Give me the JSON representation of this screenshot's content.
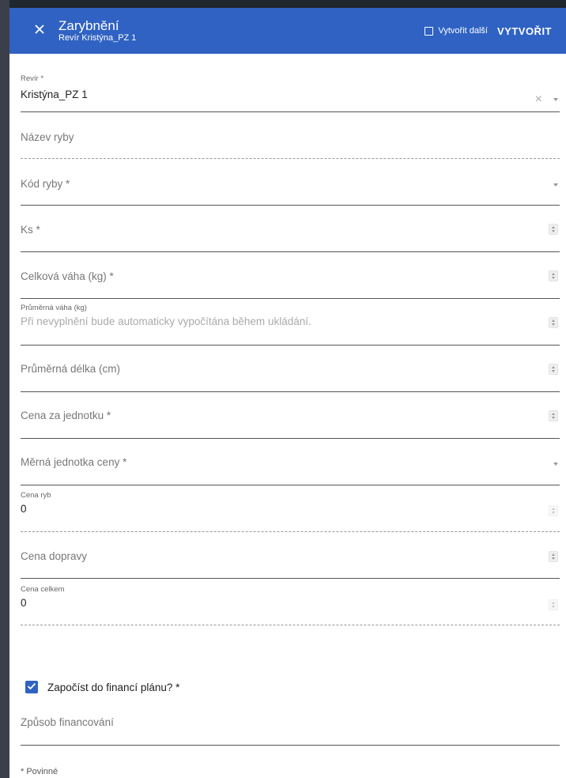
{
  "header": {
    "title": "Zarybnění",
    "subtitle": "Revír Kristýna_PZ 1",
    "create_another_label": "Vytvořit další",
    "create_button_label": "VYTVOŘIT"
  },
  "fields": {
    "revir": {
      "label": "Revír *",
      "value": "Kristýna_PZ 1"
    },
    "nazev_ryby": {
      "placeholder": "Název ryby"
    },
    "kod_ryby": {
      "placeholder": "Kód ryby *"
    },
    "ks": {
      "placeholder": "Ks *"
    },
    "celkova_vaha": {
      "placeholder": "Celková váha (kg) *"
    },
    "prumerna_vaha": {
      "label": "Průměrná váha (kg)",
      "hint": "Při nevyplnění bude automaticky vypočítána během ukládání."
    },
    "prumerna_delka": {
      "placeholder": "Průměrná délka (cm)"
    },
    "cena_za_jednotku": {
      "placeholder": "Cena za jednotku *"
    },
    "merna_jednotka": {
      "placeholder": "Měrná jednotka ceny *"
    },
    "cena_ryb": {
      "label": "Cena ryb",
      "value": "0"
    },
    "cena_dopravy": {
      "placeholder": "Cena dopravy"
    },
    "cena_celkem": {
      "label": "Cena celkem",
      "value": "0"
    },
    "zapocist": {
      "label": "Započíst do financí plánu? *",
      "checked": true
    },
    "zpusob_financovani": {
      "placeholder": "Způsob financování"
    }
  },
  "footer": {
    "required_note": "* Povinné"
  },
  "colors": {
    "accent": "#2f62c3"
  },
  "icons": {
    "close": "close-icon",
    "clear": "clear-icon",
    "dropdown": "chevron-down-icon",
    "spinner": "number-spinner-icon",
    "check": "check-icon"
  }
}
